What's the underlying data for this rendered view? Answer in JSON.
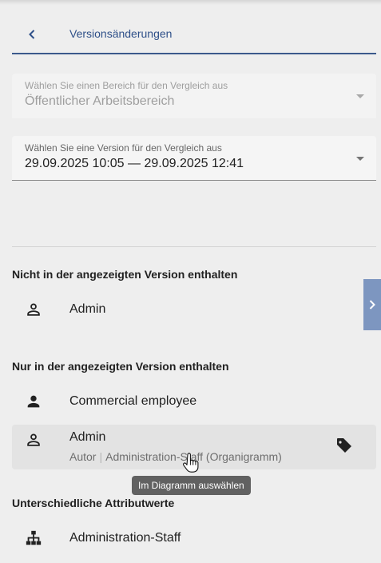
{
  "header": {
    "title": "Versionsänderungen"
  },
  "workspace_field": {
    "label": "Wählen Sie einen Bereich für den Vergleich aus",
    "value": "Öffentlicher Arbeitsbereich"
  },
  "version_field": {
    "label": "Wählen Sie eine Version für den Vergleich aus",
    "value": "29.09.2025 10:05 — 29.09.2025 12:41"
  },
  "sections": {
    "not_in_version": {
      "title": "Nicht in der angezeigten Version enthalten",
      "items": [
        {
          "name": "Admin",
          "icon": "person-outline-icon"
        }
      ]
    },
    "only_in_version": {
      "title": "Nur in der angezeigten Version enthalten",
      "items": [
        {
          "name": "Commercial employee",
          "icon": "person-filled-icon"
        },
        {
          "name": "Admin",
          "icon": "person-outline-icon",
          "role": "Autor",
          "context": "Administration-Staff (Organigramm)"
        }
      ]
    },
    "different_attributes": {
      "title": "Unterschiedliche Attributwerte",
      "items": [
        {
          "name": "Administration-Staff",
          "icon": "org-chart-icon"
        }
      ]
    }
  },
  "tooltip": {
    "text": "Im Diagramm auswählen"
  },
  "colors": {
    "accent": "#2f5089",
    "side_tab": "#7d96c0",
    "tooltip_bg": "#616161"
  }
}
